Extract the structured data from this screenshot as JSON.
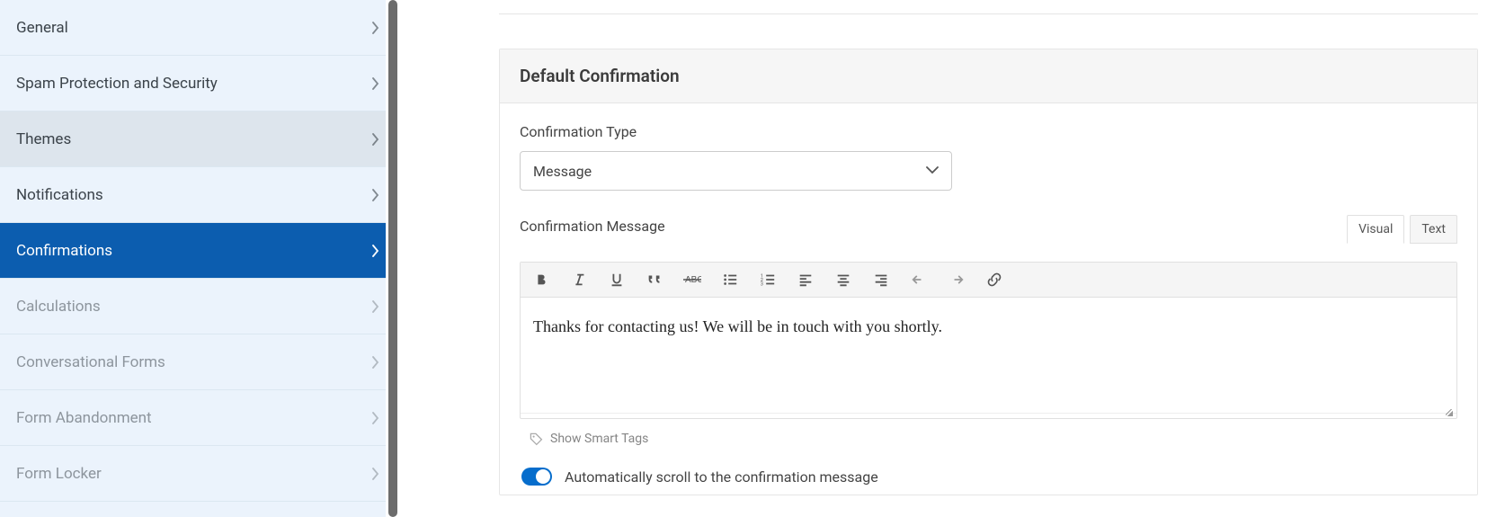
{
  "sidebar": {
    "items": [
      {
        "label": "General",
        "state": "normal"
      },
      {
        "label": "Spam Protection and Security",
        "state": "normal"
      },
      {
        "label": "Themes",
        "state": "hover"
      },
      {
        "label": "Notifications",
        "state": "normal"
      },
      {
        "label": "Confirmations",
        "state": "active"
      },
      {
        "label": "Calculations",
        "state": "disabled"
      },
      {
        "label": "Conversational Forms",
        "state": "disabled"
      },
      {
        "label": "Form Abandonment",
        "state": "disabled"
      },
      {
        "label": "Form Locker",
        "state": "disabled"
      }
    ]
  },
  "panel": {
    "title": "Default Confirmation",
    "type_label": "Confirmation Type",
    "type_value": "Message",
    "message_label": "Confirmation Message",
    "message_value": "Thanks for contacting us! We will be in touch with you shortly.",
    "tab_visual": "Visual",
    "tab_text": "Text",
    "smart_tags": "Show Smart Tags",
    "autoscroll": "Automatically scroll to the confirmation message"
  },
  "toolbar_icons": [
    "bold-icon",
    "italic-icon",
    "underline-icon",
    "blockquote-icon",
    "strikethrough-icon",
    "bullet-list-icon",
    "number-list-icon",
    "align-left-icon",
    "align-center-icon",
    "align-right-icon",
    "undo-icon",
    "redo-icon",
    "link-icon"
  ]
}
